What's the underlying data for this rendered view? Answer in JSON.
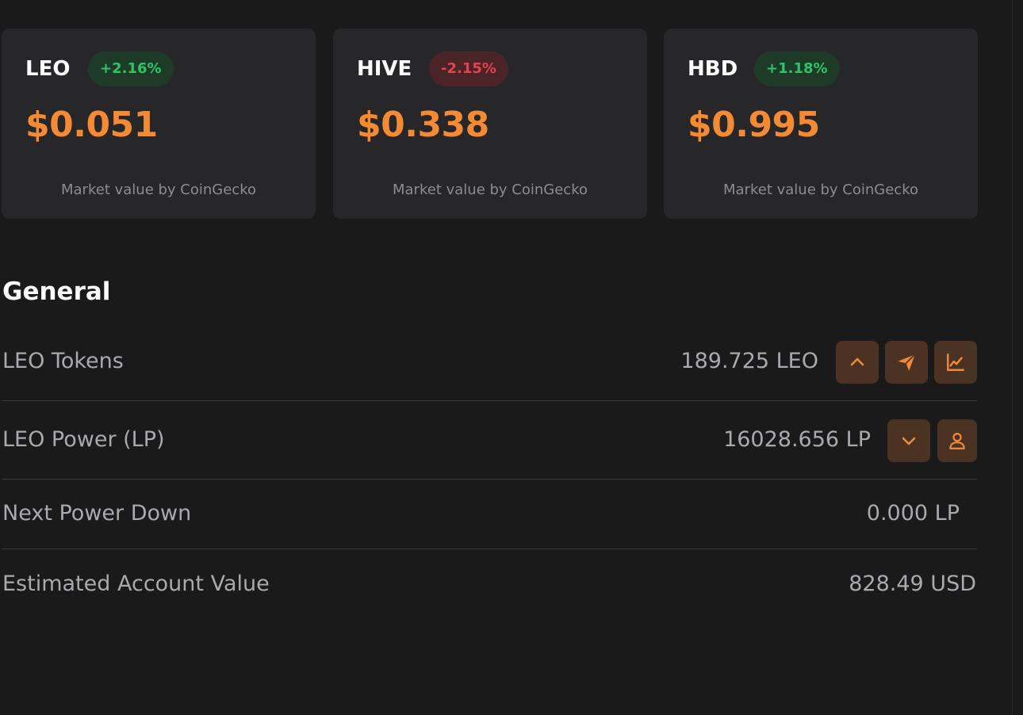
{
  "cards": [
    {
      "symbol": "LEO",
      "change": "+2.16%",
      "direction": "up",
      "price": "$0.051",
      "note": "Market value by CoinGecko"
    },
    {
      "symbol": "HIVE",
      "change": "-2.15%",
      "direction": "down",
      "price": "$0.338",
      "note": "Market value by CoinGecko"
    },
    {
      "symbol": "HBD",
      "change": "+1.18%",
      "direction": "up",
      "price": "$0.995",
      "note": "Market value by CoinGecko"
    }
  ],
  "general": {
    "title": "General",
    "rows": [
      {
        "label": "LEO Tokens",
        "value": "189.725 LEO",
        "actions": [
          "chevron-up-icon",
          "send-icon",
          "chart-line-icon"
        ]
      },
      {
        "label": "LEO Power (LP)",
        "value": "16028.656 LP",
        "actions": [
          "chevron-down-icon",
          "user-icon"
        ]
      },
      {
        "label": "Next Power Down",
        "value": "0.000 LP",
        "actions": []
      },
      {
        "label": "Estimated Account Value",
        "value": "828.49 USD",
        "actions": []
      }
    ]
  },
  "colors": {
    "background": "#1a1a1b",
    "card": "#27272a",
    "accent": "#f58a35",
    "positive": "#2dc468",
    "negative": "#e4434a",
    "button": "#4a3322"
  }
}
